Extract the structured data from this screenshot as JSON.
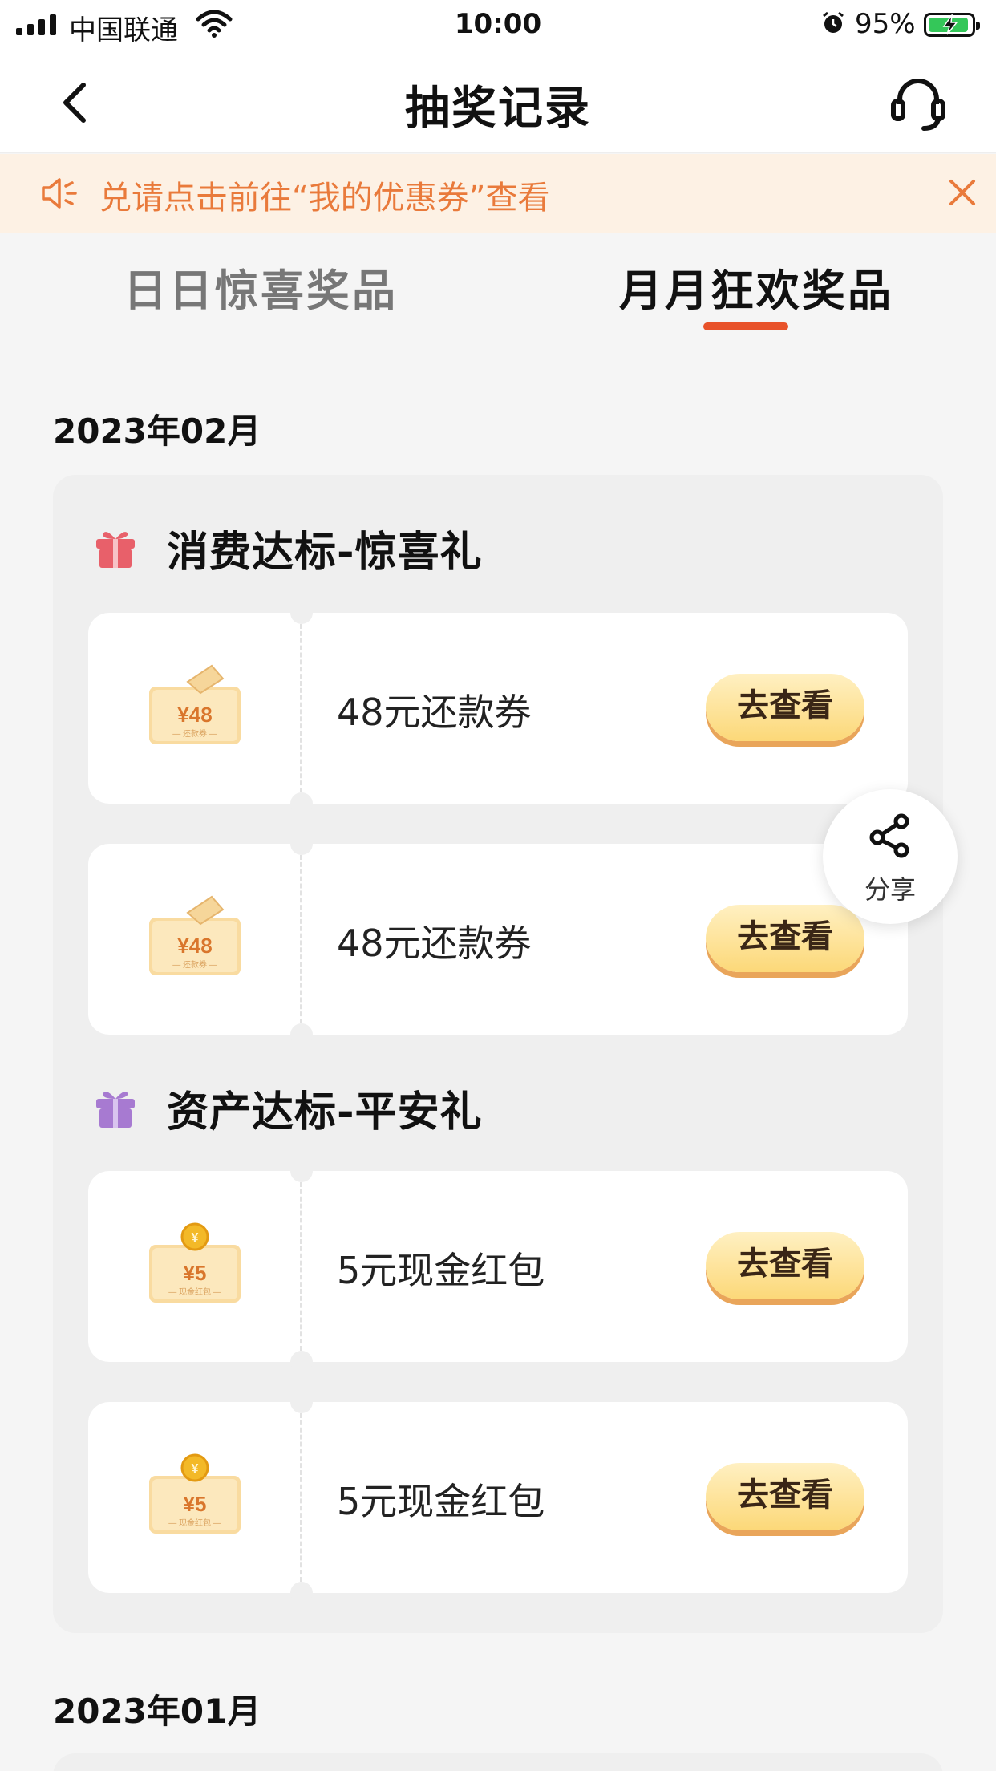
{
  "status_bar": {
    "carrier": "中国联通",
    "time": "10:00",
    "battery": "95%",
    "battery_level": 0.95
  },
  "nav": {
    "title": "抽奖记录",
    "back_icon": "chevron-left-icon",
    "service_icon": "headset-icon"
  },
  "notice": {
    "text": "兑请点击前往“我的优惠券”查看",
    "icon": "speaker-icon",
    "close_icon": "close-icon"
  },
  "tabs": [
    {
      "label": "日日惊喜奖品",
      "active": false
    },
    {
      "label": "月月狂欢奖品",
      "active": true
    }
  ],
  "sections": [
    {
      "month": "2023年02月",
      "groups": [
        {
          "title": "消费达标-惊喜礼",
          "icon_color": "#e8606a",
          "items": [
            {
              "name": "48元还款券",
              "amount": "¥48",
              "sub": "— 还款券 —",
              "button": "去查看"
            },
            {
              "name": "48元还款券",
              "amount": "¥48",
              "sub": "— 还款券 —",
              "button": "去查看"
            }
          ]
        },
        {
          "title": "资产达标-平安礼",
          "icon_color": "#a77ad1",
          "items": [
            {
              "name": "5元现金红包",
              "amount": "¥5",
              "sub": "— 现金红包 —",
              "button": "去查看"
            },
            {
              "name": "5元现金红包",
              "amount": "¥5",
              "sub": "— 现金红包 —",
              "button": "去查看"
            }
          ]
        }
      ]
    },
    {
      "month": "2023年01月"
    }
  ],
  "share": {
    "label": "分享",
    "icon": "share-icon"
  },
  "colors": {
    "accent": "#e8522a",
    "notice_text": "#e97a3b",
    "button_shadow": "#e9a55a"
  }
}
